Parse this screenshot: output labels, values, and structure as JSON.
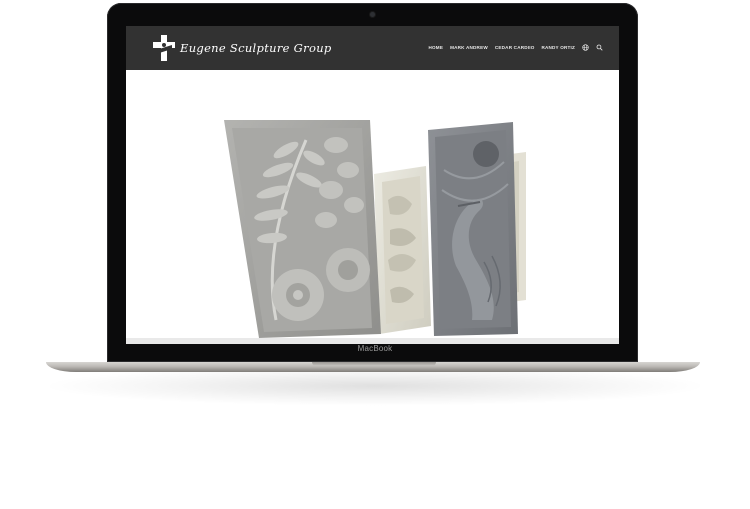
{
  "device": {
    "brand_label": "MacBook"
  },
  "site": {
    "logo_text": "Eugene Sculpture Group",
    "nav": {
      "items": [
        {
          "label": "HOME"
        },
        {
          "label": "MARK ANDREW"
        },
        {
          "label": "CEDAR CARDIIO"
        },
        {
          "label": "RANDY ORTIZ"
        }
      ],
      "icons": [
        "globe-icon",
        "search-icon"
      ]
    },
    "hero": {
      "image": "carved-stone-relief-panels",
      "panels": [
        "fern-and-flower-relief",
        "small-floral-relief",
        "heron-relief"
      ]
    }
  },
  "colors": {
    "navbar": "#323232",
    "bezel": "#0b0b0c",
    "body_aluminum": "#bcb9b5"
  }
}
